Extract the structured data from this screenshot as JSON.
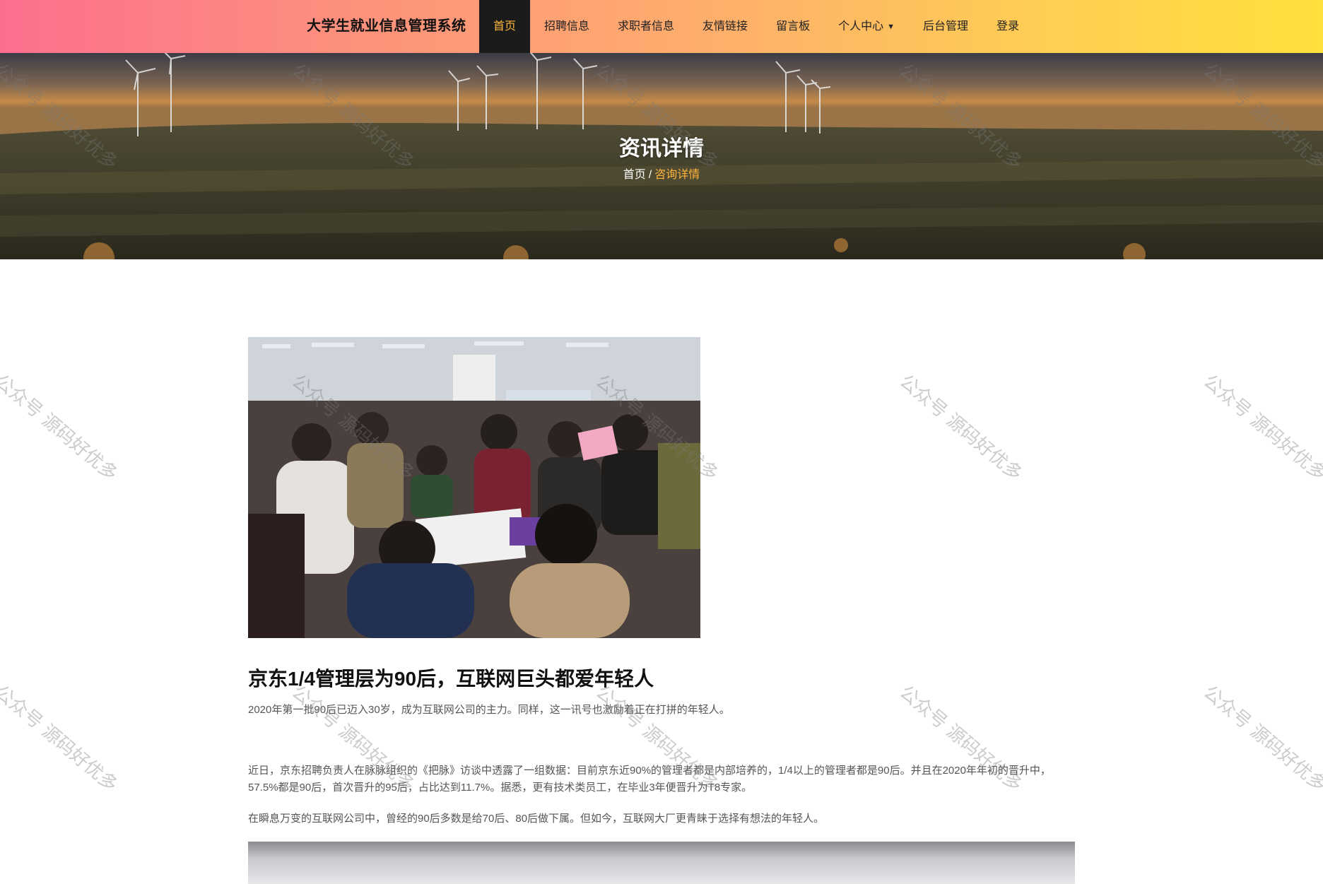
{
  "header": {
    "brand": "大学生就业信息管理系统",
    "nav": [
      {
        "label": "首页",
        "active": true
      },
      {
        "label": "招聘信息"
      },
      {
        "label": "求职者信息"
      },
      {
        "label": "友情链接"
      },
      {
        "label": "留言板"
      },
      {
        "label": "个人中心",
        "dropdown": true
      },
      {
        "label": "后台管理"
      },
      {
        "label": "登录"
      }
    ],
    "colors": {
      "gradient_start": "#fb6f8e",
      "gradient_end": "#ffe03c",
      "active_bg": "#1b1b1b",
      "accent": "#ffb43c"
    }
  },
  "hero": {
    "title": "资讯详情",
    "breadcrumb": {
      "home": "首页",
      "separator": "/",
      "current": "咨询详情"
    }
  },
  "article": {
    "title": "京东1/4管理层为90后，互联网巨头都爱年轻人",
    "summary": "2020年第一批90后已迈入30岁，成为互联网公司的主力。同样，这一讯号也激励着正在打拼的年轻人。",
    "paragraphs": [
      "近日，京东招聘负责人在脉脉组织的《把脉》访谈中透露了一组数据：目前京东近90%的管理者都是内部培养的，1/4以上的管理者都是90后。并且在2020年年初的晋升中，57.5%都是90后，首次晋升的95后，占比达到11.7%。据悉，更有技术类员工，在毕业3年便晋升为T8专家。",
      "在瞬息万变的互联网公司中，曾经的90后多数是给70后、80后做下属。但如今，互联网大厂更青睐于选择有想法的年轻人。"
    ]
  },
  "watermark": "公众号 源码好优多"
}
